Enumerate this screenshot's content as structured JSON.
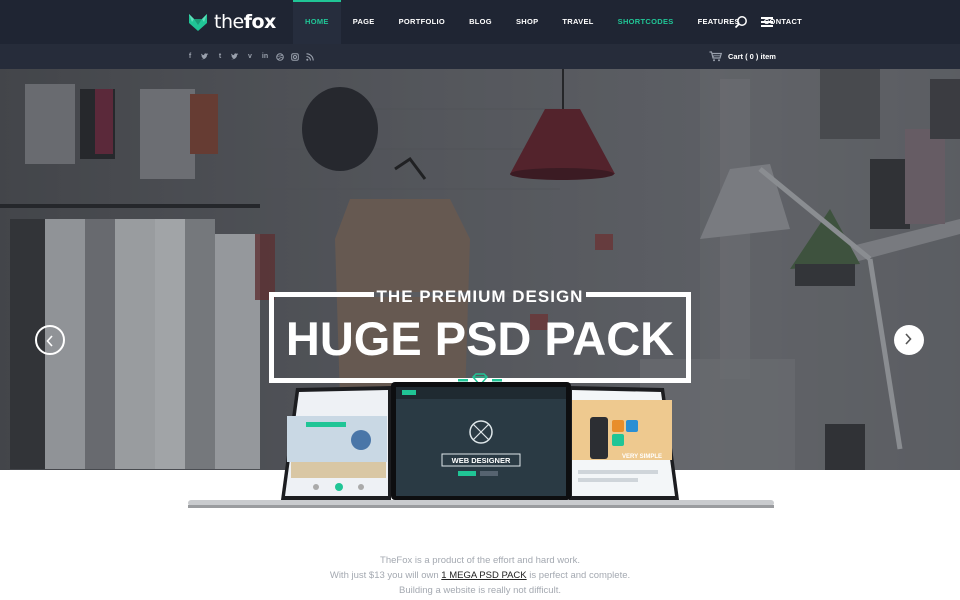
{
  "brand": {
    "logo_the": "the",
    "logo_fox": "fox",
    "accent": "#20c596",
    "nav_bg": "#1f2533"
  },
  "nav": {
    "items": [
      {
        "label": "HOME",
        "state": "active"
      },
      {
        "label": "PAGE",
        "state": "normal"
      },
      {
        "label": "PORTFOLIO",
        "state": "normal"
      },
      {
        "label": "BLOG",
        "state": "normal"
      },
      {
        "label": "SHOP",
        "state": "normal"
      },
      {
        "label": "TRAVEL",
        "state": "normal"
      },
      {
        "label": "SHORTCODES",
        "state": "hover"
      },
      {
        "label": "FEATURES",
        "state": "normal"
      },
      {
        "label": "CONTACT",
        "state": "normal"
      }
    ],
    "search_icon": "search-icon",
    "menu_icon": "hamburger-menu-icon"
  },
  "social": {
    "icons": [
      "facebook-icon",
      "twitter-icon",
      "tumblr-icon",
      "twitter-bird-icon",
      "vimeo-icon",
      "linkedin-icon",
      "dribbble-icon",
      "instagram-icon",
      "rss-icon"
    ],
    "glyphs": [
      "f",
      "t",
      "t",
      "t",
      "v",
      "in",
      "d",
      "o",
      "r"
    ]
  },
  "cart": {
    "label": "Cart ( 0 ) item",
    "icon": "cart-icon"
  },
  "hero": {
    "subtitle": "THE PREMIUM DESIGN",
    "title": "HUGE PSD PACK",
    "prev_icon": "chevron-left-icon",
    "next_icon": "chevron-right-icon",
    "scroll_icon": "chevron-down-icon",
    "gem_icon": "diamond-icon"
  },
  "devices": {
    "center_screen_text": "WEB DESIGNER",
    "right_screen_text": "VERY SIMPLE"
  },
  "intro": {
    "line1": "TheFox is a product of the effort and hard work.",
    "line2_pre": "With just $13 you will own ",
    "line2_link": "1 MEGA PSD PACK",
    "line2_post": " is perfect and complete.",
    "line3": "Building a website is really not difficult."
  }
}
